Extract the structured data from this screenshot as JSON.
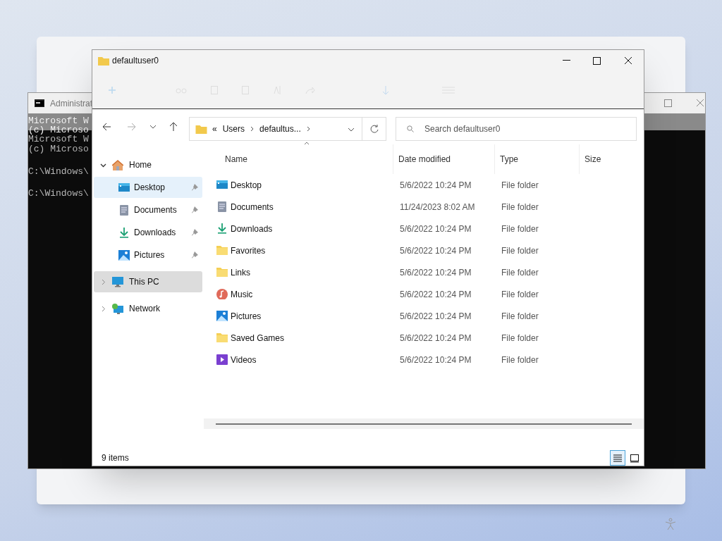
{
  "console_window": {
    "title": "Administrat",
    "lines": [
      {
        "text": "Microsoft W",
        "ghost": true
      },
      {
        "text": "(c) Microso",
        "ghost": true
      },
      {
        "text": "Microsoft W",
        "ghost": false
      },
      {
        "text": "(c) Microso",
        "ghost": false
      },
      {
        "text": "C:\\Windows\\",
        "ghost": false
      },
      {
        "text": "C:\\Windows\\",
        "ghost": false
      }
    ]
  },
  "window": {
    "title": "defaultuser0"
  },
  "address_bar": {
    "segments": [
      "«",
      "Users",
      "defaultus..."
    ]
  },
  "search": {
    "placeholder": "Search defaultuser0"
  },
  "nav_pane": [
    {
      "label": "Home",
      "kind": "home",
      "expanded": true,
      "selected": false,
      "children": [
        {
          "label": "Desktop",
          "kind": "desktop",
          "pinned": true,
          "selected": true
        },
        {
          "label": "Documents",
          "kind": "documents",
          "pinned": true,
          "selected": false
        },
        {
          "label": "Downloads",
          "kind": "downloads",
          "pinned": true,
          "selected": false
        },
        {
          "label": "Pictures",
          "kind": "pictures",
          "pinned": true,
          "selected": false
        }
      ]
    },
    {
      "label": "This PC",
      "kind": "pc",
      "expanded": false,
      "selected": true
    },
    {
      "label": "Network",
      "kind": "network",
      "expanded": false,
      "selected": false
    }
  ],
  "table": {
    "columns": [
      "Name",
      "Date modified",
      "Type",
      "Size"
    ],
    "rows": [
      {
        "name": "Desktop",
        "kind": "desktop",
        "date": "5/6/2022 10:24 PM",
        "type": "File folder"
      },
      {
        "name": "Documents",
        "kind": "documents",
        "date": "11/24/2023 8:02 AM",
        "type": "File folder"
      },
      {
        "name": "Downloads",
        "kind": "downloads",
        "date": "5/6/2022 10:24 PM",
        "type": "File folder"
      },
      {
        "name": "Favorites",
        "kind": "folder",
        "date": "5/6/2022 10:24 PM",
        "type": "File folder"
      },
      {
        "name": "Links",
        "kind": "folder",
        "date": "5/6/2022 10:24 PM",
        "type": "File folder"
      },
      {
        "name": "Music",
        "kind": "music",
        "date": "5/6/2022 10:24 PM",
        "type": "File folder"
      },
      {
        "name": "Pictures",
        "kind": "pictures",
        "date": "5/6/2022 10:24 PM",
        "type": "File folder"
      },
      {
        "name": "Saved Games",
        "kind": "folder",
        "date": "5/6/2022 10:24 PM",
        "type": "File folder"
      },
      {
        "name": "Videos",
        "kind": "videos",
        "date": "5/6/2022 10:24 PM",
        "type": "File folder"
      }
    ]
  },
  "status_bar": {
    "count": "9 items",
    "views": [
      {
        "kind": "details",
        "selected": true
      },
      {
        "kind": "tiles",
        "selected": false
      }
    ]
  }
}
